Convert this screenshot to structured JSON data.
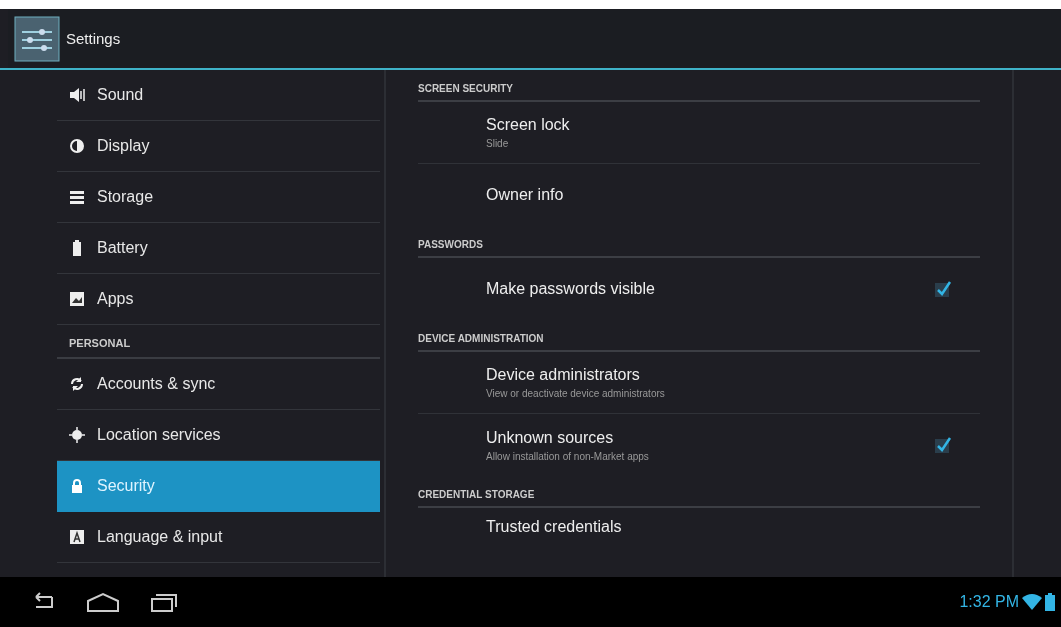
{
  "action_bar": {
    "title": "Settings"
  },
  "sidebar": {
    "items": [
      {
        "kind": "item",
        "label": "Sound",
        "selected": false
      },
      {
        "kind": "item",
        "label": "Display",
        "selected": false
      },
      {
        "kind": "item",
        "label": "Storage",
        "selected": false
      },
      {
        "kind": "item",
        "label": "Battery",
        "selected": false
      },
      {
        "kind": "item",
        "label": "Apps",
        "selected": false
      },
      {
        "kind": "header",
        "label": "PERSONAL"
      },
      {
        "kind": "item",
        "label": "Accounts & sync",
        "selected": false
      },
      {
        "kind": "item",
        "label": "Location services",
        "selected": false
      },
      {
        "kind": "item",
        "label": "Security",
        "selected": true
      },
      {
        "kind": "item",
        "label": "Language & input",
        "selected": false
      }
    ]
  },
  "panel": {
    "sections": [
      {
        "header": "SCREEN SECURITY",
        "items": [
          {
            "title": "Screen lock",
            "summary": "Slide"
          },
          {
            "title": "Owner info"
          }
        ]
      },
      {
        "header": "PASSWORDS",
        "items": [
          {
            "title": "Make passwords visible",
            "checked": true
          }
        ]
      },
      {
        "header": "DEVICE ADMINISTRATION",
        "items": [
          {
            "title": "Device administrators",
            "summary": "View or deactivate device administrators"
          },
          {
            "title": "Unknown sources",
            "summary": "Allow installation of non-Market apps",
            "checked": true
          }
        ]
      },
      {
        "header": "CREDENTIAL STORAGE",
        "items": [
          {
            "title": "Trusted credentials"
          }
        ]
      }
    ]
  },
  "status_bar": {
    "time": "1:32 PM"
  }
}
